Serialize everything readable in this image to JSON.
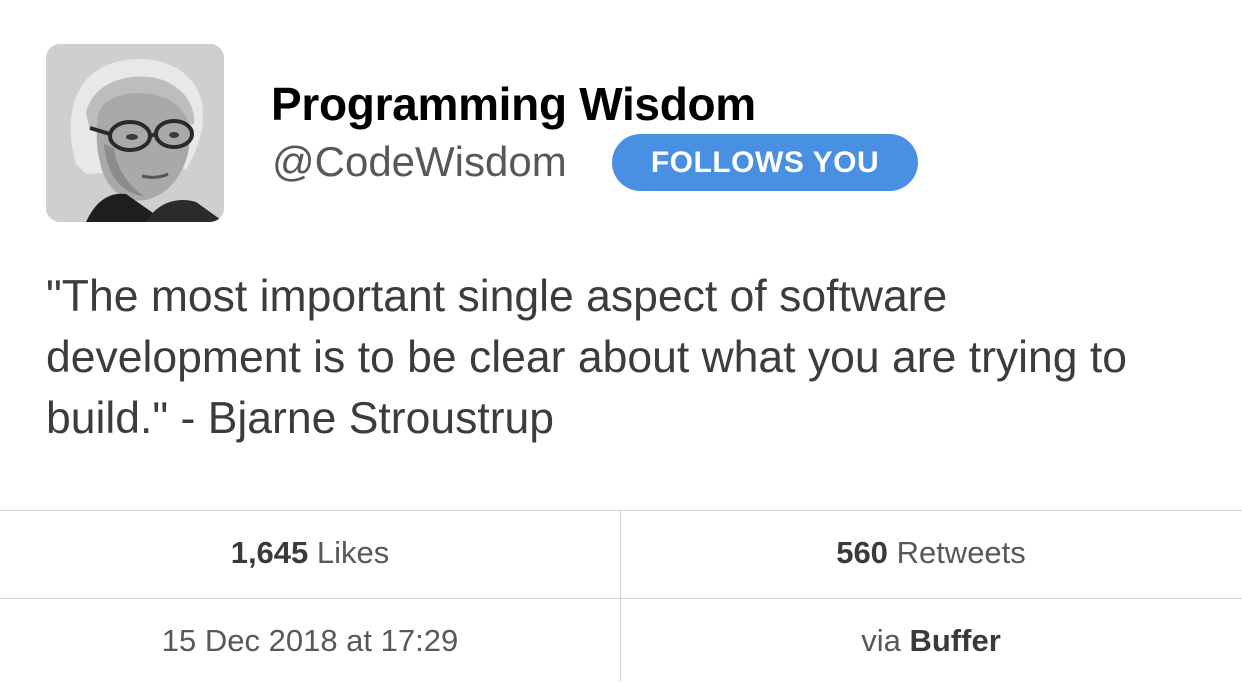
{
  "user": {
    "display_name": "Programming Wisdom",
    "handle": "@CodeWisdom",
    "follows_badge": "FOLLOWS YOU",
    "avatar_icon": "profile-photo"
  },
  "tweet": {
    "text": "\"The most important single aspect of software development is to be clear about what you are trying to build.\" - Bjarne Stroustrup"
  },
  "stats": {
    "likes_count": "1,645",
    "likes_label": "Likes",
    "retweets_count": "560",
    "retweets_label": "Retweets"
  },
  "meta": {
    "timestamp": "15 Dec 2018 at 17:29",
    "via_prefix": "via",
    "source": "Buffer"
  },
  "colors": {
    "badge_bg": "#4a90e2",
    "text_primary": "#000000",
    "text_secondary": "#585858",
    "divider": "#d4d4d4"
  }
}
